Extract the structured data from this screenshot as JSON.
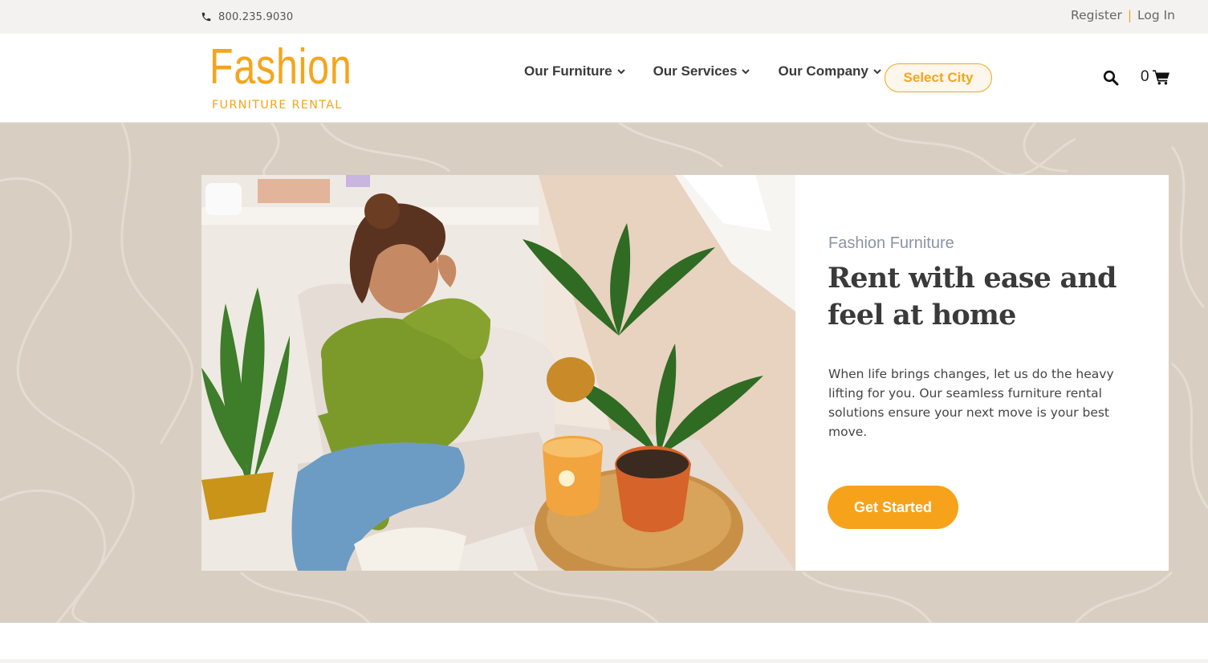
{
  "topbar": {
    "phone": "800.235.9030",
    "register": "Register",
    "separator": "|",
    "login": "Log In"
  },
  "brand": {
    "name": "Fashion",
    "tagline": "FURNITURE RENTAL",
    "accent_color": "#f5a51c"
  },
  "nav": {
    "items": [
      {
        "label": "Our Furniture",
        "icon": "chevron-down-icon"
      },
      {
        "label": "Our Services",
        "icon": "chevron-down-icon"
      },
      {
        "label": "Our Company",
        "icon": "chevron-down-icon"
      }
    ],
    "select_city": "Select City",
    "search_icon": "search-icon",
    "cart_count": "0",
    "cart_icon": "cart-icon"
  },
  "hero": {
    "eyebrow": "Fashion Furniture",
    "headline": "Rent with ease and feel at home",
    "body": "When life brings changes, let us do the heavy lifting for you. Our seamless furniture rental solutions ensure your next move is your best move.",
    "cta": "Get Started",
    "background_color": "#d8cfc2",
    "button_color": "#f7a21b"
  }
}
